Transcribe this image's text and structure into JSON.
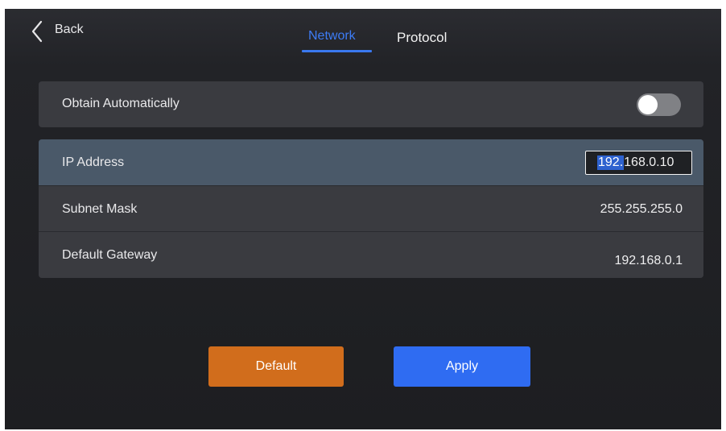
{
  "header": {
    "back_label": "Back",
    "tabs": [
      {
        "label": "Network",
        "active": true
      },
      {
        "label": "Protocol",
        "active": false
      }
    ]
  },
  "settings": {
    "obtain_automatically": {
      "label": "Obtain Automatically",
      "enabled": false
    },
    "ip_address": {
      "label": "IP Address",
      "value_selected": "192.",
      "value_rest": "168.0.10"
    },
    "subnet_mask": {
      "label": "Subnet Mask",
      "value": "255.255.255.0"
    },
    "default_gateway": {
      "label": "Default Gateway",
      "value": "192.168.0.1"
    }
  },
  "actions": {
    "default_label": "Default",
    "apply_label": "Apply"
  },
  "colors": {
    "accent": "#3a78ef",
    "default_button": "#d16d1c",
    "apply_button": "#2f6cf2",
    "selected_row": "#4a5969"
  }
}
